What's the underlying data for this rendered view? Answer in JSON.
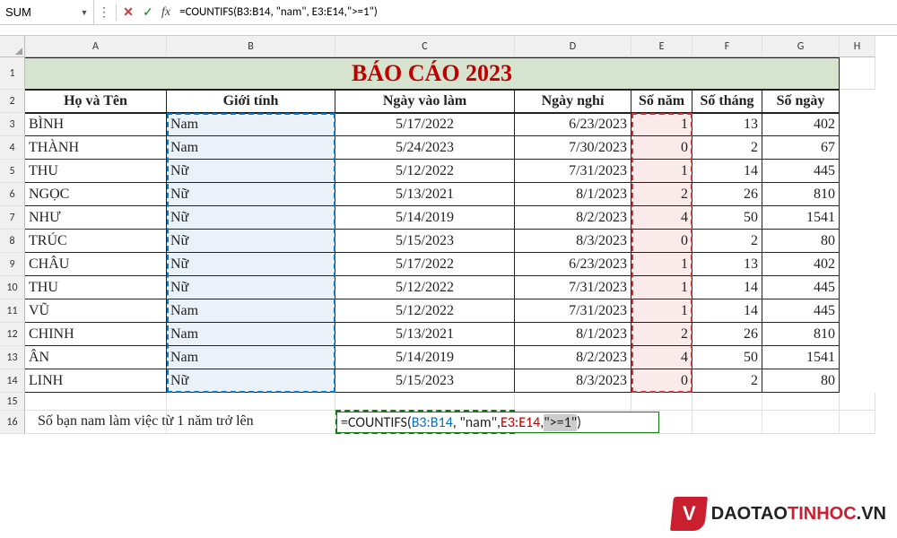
{
  "name_box": "SUM",
  "formula_bar": "=COUNTIFS(B3:B14, \"nam\", E3:E14,\">=1\")",
  "columns": [
    "A",
    "B",
    "C",
    "D",
    "E",
    "F",
    "G",
    "H"
  ],
  "row_numbers": [
    "1",
    "2",
    "3",
    "4",
    "5",
    "6",
    "7",
    "8",
    "9",
    "10",
    "11",
    "12",
    "13",
    "14",
    "15",
    "16"
  ],
  "title": "BÁO CÁO 2023",
  "headers": {
    "name": "Họ và Tên",
    "gender": "Giới tính",
    "start": "Ngày vào làm",
    "end": "Ngày nghỉ",
    "years": "Số năm",
    "months": "Số tháng",
    "days": "Số ngày"
  },
  "rows": [
    {
      "name": "BÌNH",
      "gender": "Nam",
      "start": "5/17/2022",
      "end": "6/23/2023",
      "years": "1",
      "months": "13",
      "days": "402"
    },
    {
      "name": "THÀNH",
      "gender": "Nam",
      "start": "5/24/2023",
      "end": "7/30/2023",
      "years": "0",
      "months": "2",
      "days": "67"
    },
    {
      "name": "THU",
      "gender": "Nữ",
      "start": "5/12/2022",
      "end": "7/31/2023",
      "years": "1",
      "months": "14",
      "days": "445"
    },
    {
      "name": "NGỌC",
      "gender": "Nữ",
      "start": "5/13/2021",
      "end": "8/1/2023",
      "years": "2",
      "months": "26",
      "days": "810"
    },
    {
      "name": "NHƯ",
      "gender": "Nữ",
      "start": "5/14/2019",
      "end": "8/2/2023",
      "years": "4",
      "months": "50",
      "days": "1541"
    },
    {
      "name": "TRÚC",
      "gender": "Nữ",
      "start": "5/15/2023",
      "end": "8/3/2023",
      "years": "0",
      "months": "2",
      "days": "80"
    },
    {
      "name": "CHÂU",
      "gender": "Nữ",
      "start": "5/17/2022",
      "end": "6/23/2023",
      "years": "1",
      "months": "13",
      "days": "402"
    },
    {
      "name": "THU",
      "gender": "Nữ",
      "start": "5/12/2022",
      "end": "7/31/2023",
      "years": "1",
      "months": "14",
      "days": "445"
    },
    {
      "name": "VŨ",
      "gender": "Nam",
      "start": "5/12/2022",
      "end": "7/31/2023",
      "years": "1",
      "months": "14",
      "days": "445"
    },
    {
      "name": "CHINH",
      "gender": "Nam",
      "start": "5/13/2021",
      "end": "8/1/2023",
      "years": "2",
      "months": "26",
      "days": "810"
    },
    {
      "name": "ÂN",
      "gender": "Nam",
      "start": "5/14/2019",
      "end": "8/2/2023",
      "years": "4",
      "months": "50",
      "days": "1541"
    },
    {
      "name": "LINH",
      "gender": "Nữ",
      "start": "5/15/2023",
      "end": "8/3/2023",
      "years": "0",
      "months": "2",
      "days": "80"
    }
  ],
  "caption_text": "Số bạn nam làm việc từ 1 năm trở lên",
  "edit_formula": {
    "prefix": "=COUNTIFS(",
    "r1": "B3:B14",
    "m1": ", \"nam\", ",
    "r2": "E3:E14",
    "m2": ",",
    "lit": "\">=1\"",
    "suffix": ")"
  },
  "logo": {
    "mark": "V",
    "text_pre": "DAOTAO",
    "text_red": "TINHOC",
    "text_suf": ".VN"
  }
}
